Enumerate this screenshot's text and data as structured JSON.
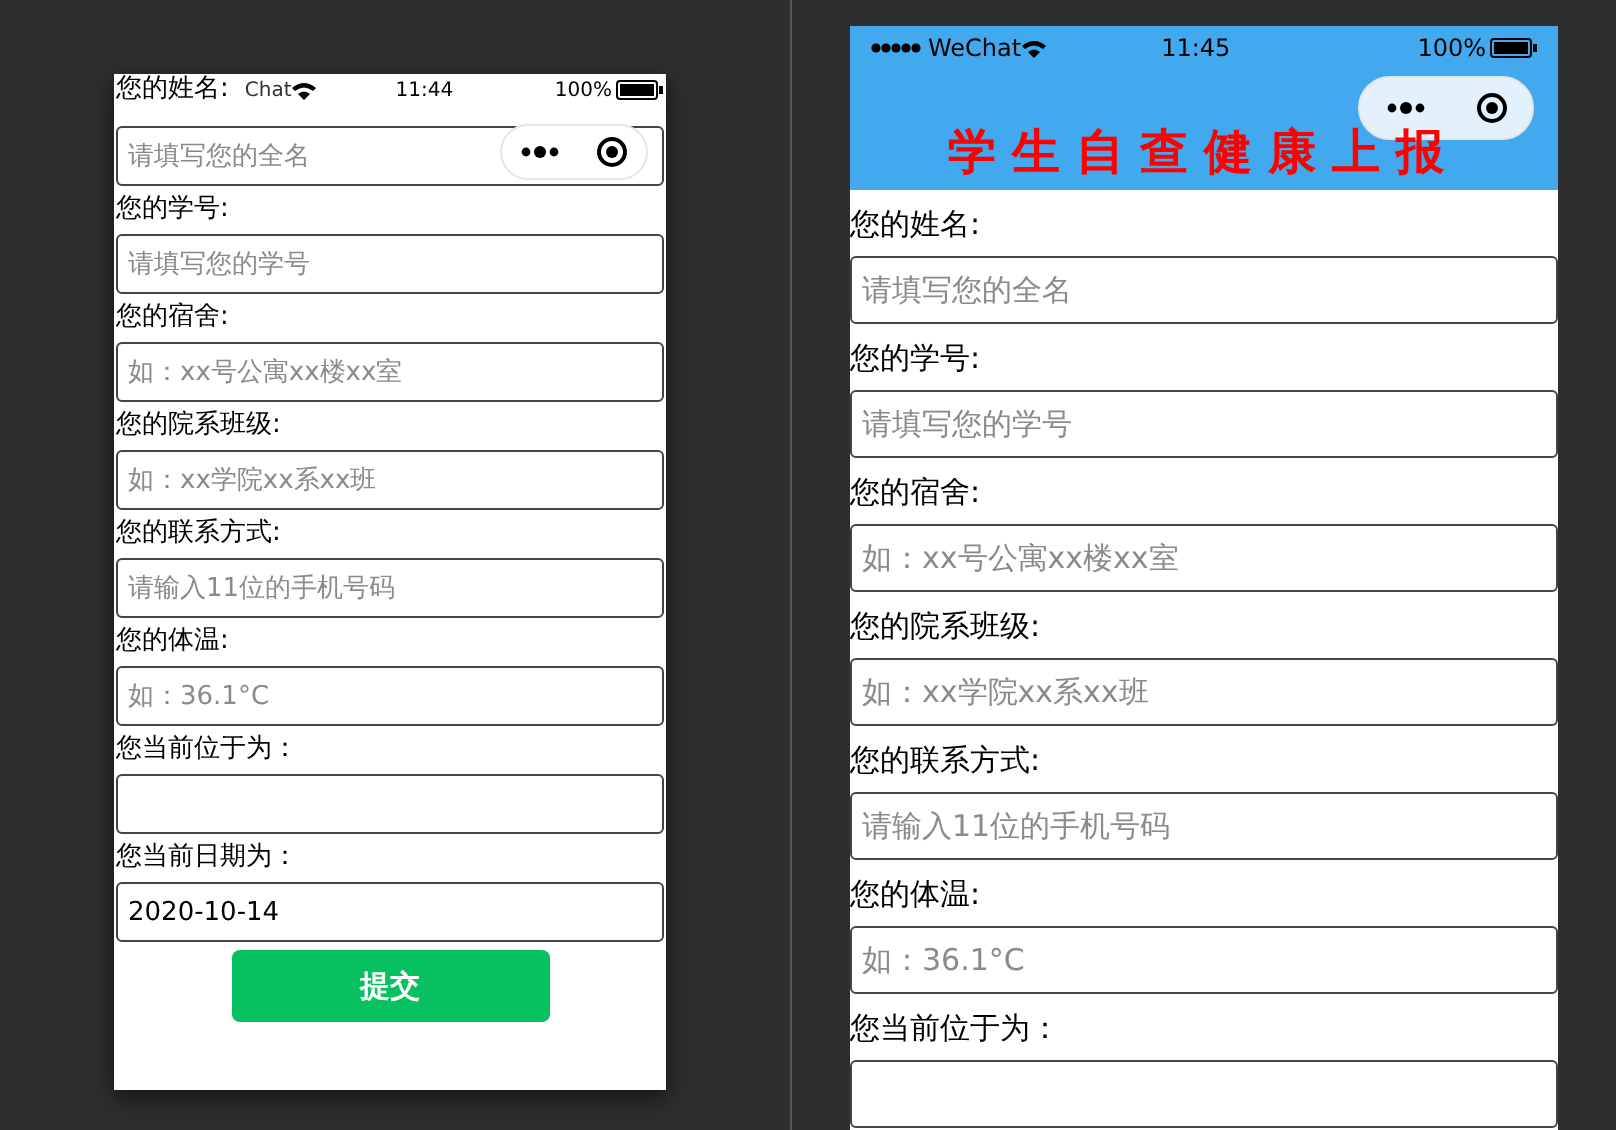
{
  "left_phone": {
    "status_bar": {
      "carrier": "Chat",
      "time": "11:44",
      "battery": "100%"
    },
    "fields": [
      {
        "label": "您的姓名:",
        "placeholder": "请填写您的全名"
      },
      {
        "label": "您的学号:",
        "placeholder": "请填写您的学号"
      },
      {
        "label": "您的宿舍:",
        "placeholder": "如：xx号公寓xx楼xx室"
      },
      {
        "label": "您的院系班级:",
        "placeholder": "如：xx学院xx系xx班"
      },
      {
        "label": "您的联系方式:",
        "placeholder": "请输入11位的手机号码"
      },
      {
        "label": "您的体温:",
        "placeholder": "如：36.1°C"
      },
      {
        "label": "您当前位于为："
      },
      {
        "label": "您当前日期为：",
        "value": "2020-10-14"
      }
    ],
    "submit_button": "提交"
  },
  "right_phone": {
    "status_bar": {
      "carrier": "WeChat",
      "time": "11:45",
      "battery": "100%"
    },
    "title": "学生自查健康上报",
    "fields": [
      {
        "label": "您的姓名:",
        "placeholder": "请填写您的全名"
      },
      {
        "label": "您的学号:",
        "placeholder": "请填写您的学号"
      },
      {
        "label": "您的宿舍:",
        "placeholder": "如：xx号公寓xx楼xx室"
      },
      {
        "label": "您的院系班级:",
        "placeholder": "如：xx学院xx系xx班"
      },
      {
        "label": "您的联系方式:",
        "placeholder": "请输入11位的手机号码"
      },
      {
        "label": "您的体温:",
        "placeholder": "如：36.1°C"
      },
      {
        "label": "您当前位于为："
      }
    ]
  }
}
